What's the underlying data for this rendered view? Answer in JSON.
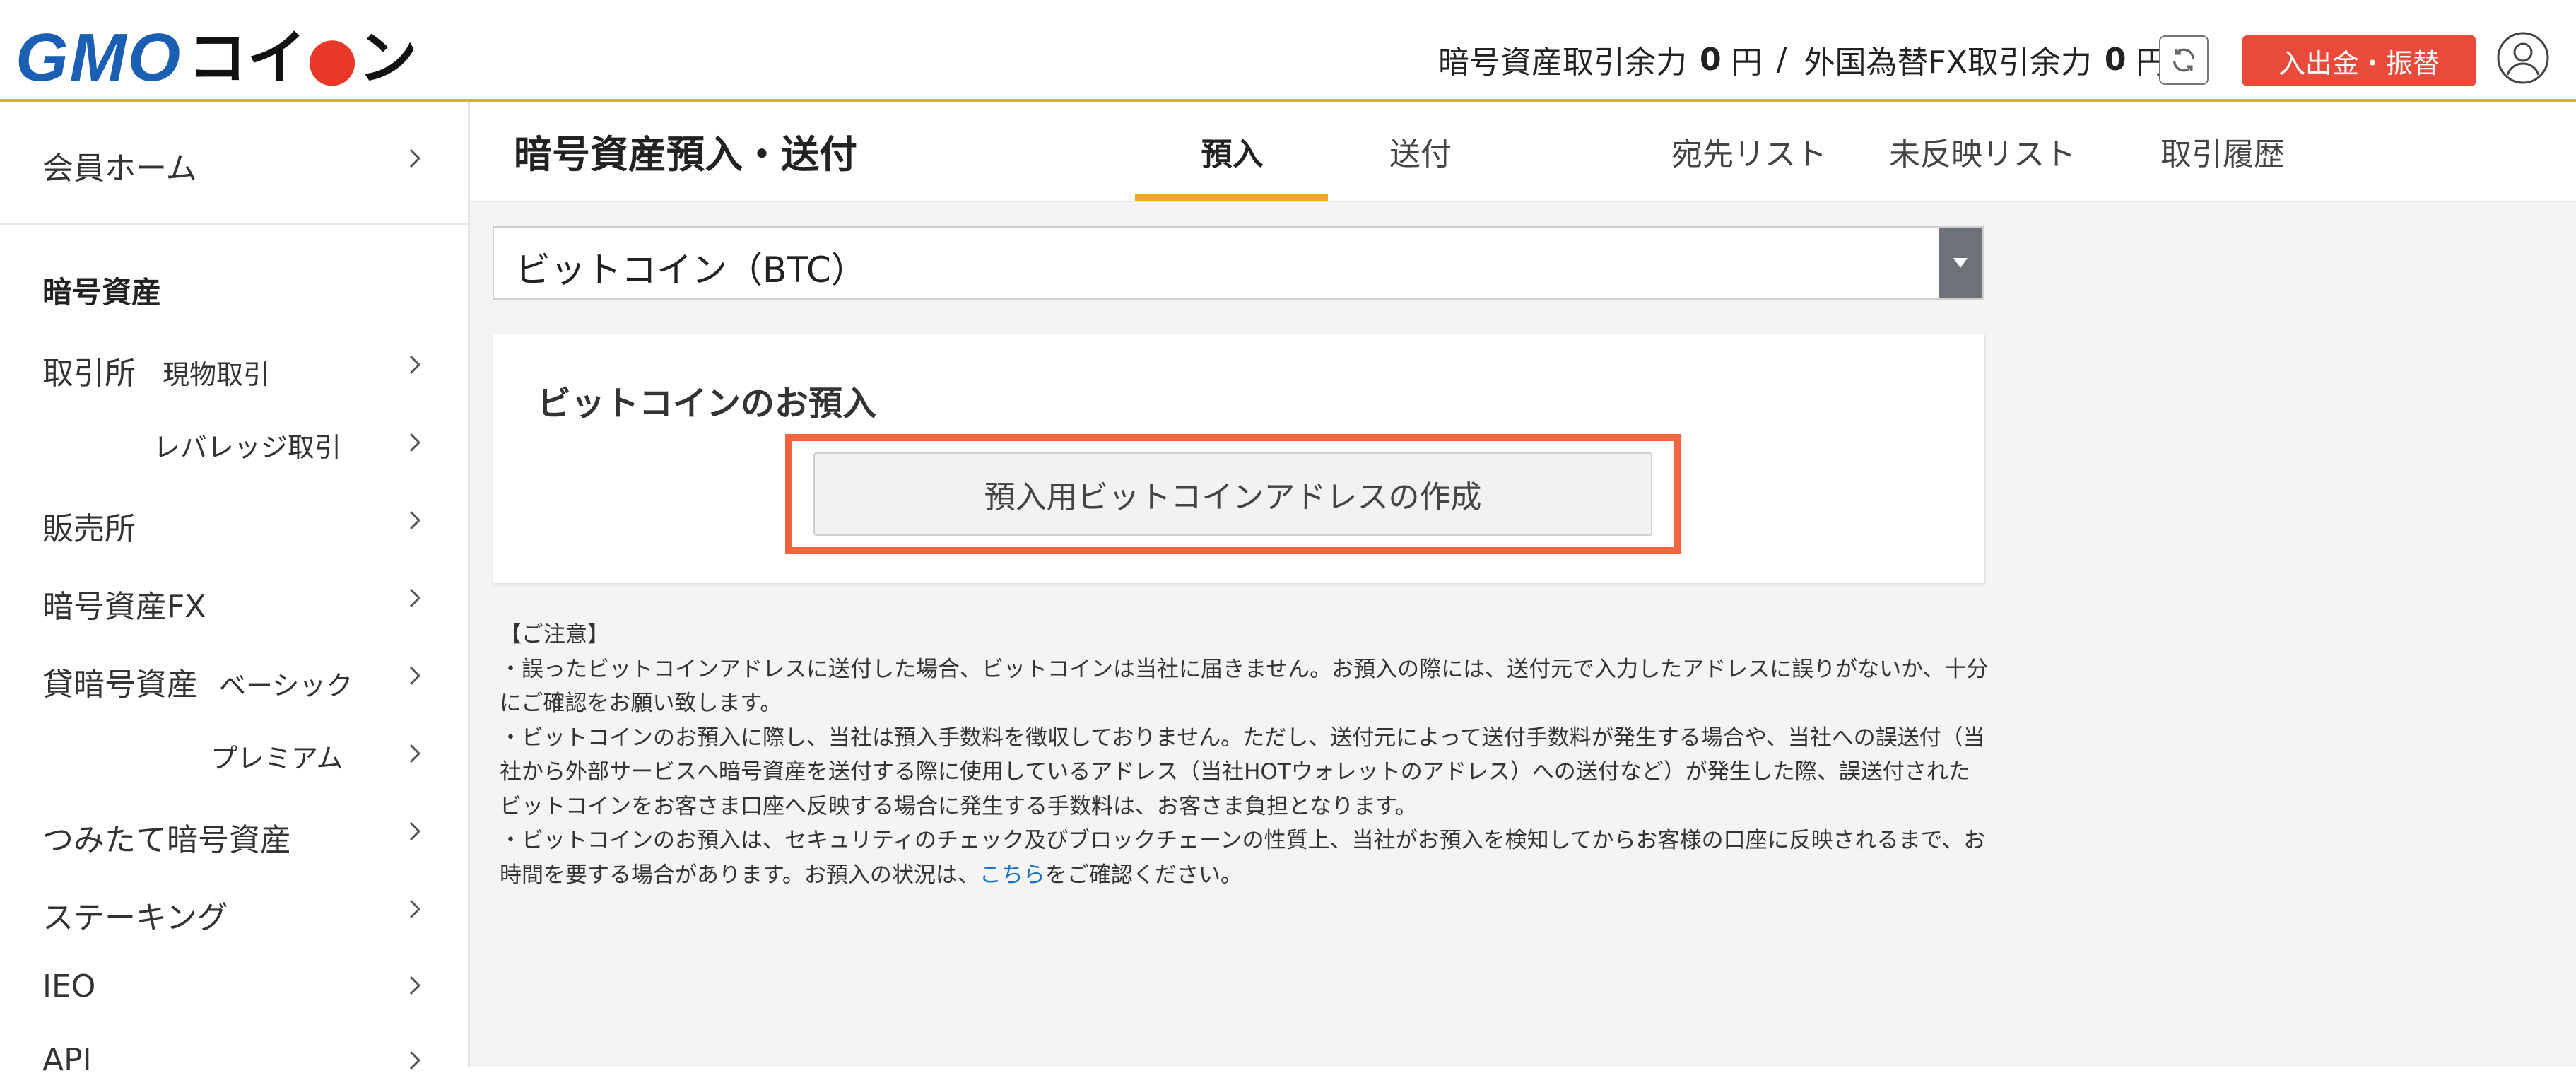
{
  "header": {
    "logo_text": "GMO",
    "logo_coin": "コイ",
    "logo_coin_end": "ン",
    "crypto_label": "暗号資産取引余力",
    "crypto_value": "0",
    "crypto_unit": "円",
    "separator": "/",
    "fx_label": "外国為替FX取引余力",
    "fx_value": "0",
    "fx_unit": "円",
    "deposit_button": "入出金・振替"
  },
  "sidebar": {
    "home": "会員ホーム",
    "section_title": "暗号資産",
    "items": [
      {
        "label": "取引所",
        "sub": "現物取引"
      },
      {
        "label": "",
        "sub": "レバレッジ取引"
      },
      {
        "label": "販売所",
        "sub": ""
      },
      {
        "label": "暗号資産FX",
        "sub": ""
      },
      {
        "label": "貸暗号資産",
        "sub": "ベーシック"
      },
      {
        "label": "",
        "sub": "プレミアム"
      },
      {
        "label": "つみたて暗号資産",
        "sub": ""
      },
      {
        "label": "ステーキング",
        "sub": ""
      },
      {
        "label": "IEO",
        "sub": ""
      },
      {
        "label": "API",
        "sub": ""
      }
    ]
  },
  "main": {
    "page_title": "暗号資産預入・送付",
    "tabs": [
      "預入",
      "送付",
      "宛先リスト",
      "未反映リスト",
      "取引履歴"
    ],
    "active_tab": "預入",
    "select_value": "ビットコイン（BTC）",
    "card_title": "ビットコインのお預入",
    "create_button": "預入用ビットコインアドレスの作成",
    "notes_heading": "【ご注意】",
    "note1": "・誤ったビットコインアドレスに送付した場合、ビットコインは当社に届きません。お預入の際には、送付元で入力したアドレスに誤りがないか、十分にご確認をお願い致します。",
    "note2": "・ビットコインのお預入に際し、当社は預入手数料を徴収しておりません。ただし、送付元によって送付手数料が発生する場合や、当社への誤送付（当社から外部サービスへ暗号資産を送付する際に使用しているアドレス（当社HOTウォレットのアドレス）への送付など）が発生した際、誤送付されたビットコインをお客さま口座へ反映する場合に発生する手数料は、お客さま負担となります。",
    "note3_pre": "・ビットコインのお預入は、セキュリティのチェック及びブロックチェーンの性質上、当社がお預入を検知してからお客様の口座に反映されるまで、お時間を要する場合があります。お預入の状況は、",
    "note3_link": "こちら",
    "note3_post": "をご確認ください。"
  },
  "colors": {
    "accent": "#f5a623",
    "brand_blue": "#1a5fb4",
    "deposit_red": "#e94a3a",
    "highlight": "#f0643f",
    "link": "#1a73c8"
  }
}
